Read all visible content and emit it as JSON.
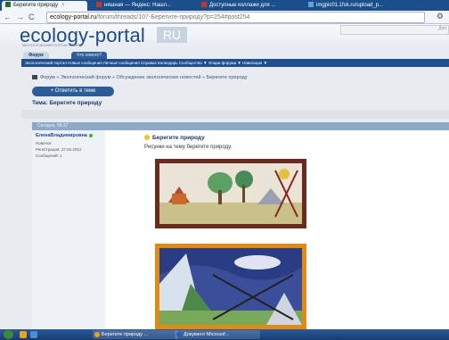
{
  "browser": {
    "tabs": [
      {
        "label": "Берегите природу",
        "active": true
      },
      {
        "label": "няшная — Яндекс: Нашл...",
        "active": false
      },
      {
        "label": "Доступные коллажи для ...",
        "active": false
      },
      {
        "label": "imgpic01.1fsk.ru/upload_p...",
        "active": false
      }
    ],
    "url_host": "ecology-portal.ru",
    "url_path": "/forum/threads/107-Берегите-природу?p=254#post254",
    "back_icon": "back-arrow-icon",
    "forward_icon": "forward-arrow-icon",
    "reload_icon": "reload-icon"
  },
  "site": {
    "logo": "ecology-portal",
    "logo_suffix": "RU",
    "slogan": "ЭКОЛОГИЧЕСКИЙ ПОРТАЛ СФЕРЫ",
    "search_placeholder": "Доп"
  },
  "forum_tabs": {
    "active": "Форум",
    "other": "Что нового?"
  },
  "navstrip": "Экологический портал  Новые сообщения  Личные сообщения  Справка  Календарь  Сообщество ▼  Опции форума ▼  Навигация ▼",
  "breadcrumb": "Форум  »  Экологический форум  »  Обсуждение экологических новостей  »  Берегите природу",
  "reply_button": "+ Ответить в теме",
  "thread_title": "Тема: Берегите природу",
  "post": {
    "date": "Сегодня, 05:37",
    "username": "ЕленаВладимировна",
    "role": "Новичок",
    "registered_label": "Регистрация:",
    "registered_value": "27.02.2012",
    "messages_label": "Сообщений:",
    "messages_value": "1",
    "title": "Берегите природу",
    "text": "Рисунки на тему берегите природу."
  },
  "taskbar": {
    "item1": "Берегите природу ...",
    "item2": "Документ Microsof..."
  },
  "colors": {
    "brand": "#1d4a8a",
    "navstrip": "#1f4f8f",
    "taskbar": "#1b4f8c",
    "frame1": "#6b2a1e",
    "frame2": "#e08a14"
  }
}
